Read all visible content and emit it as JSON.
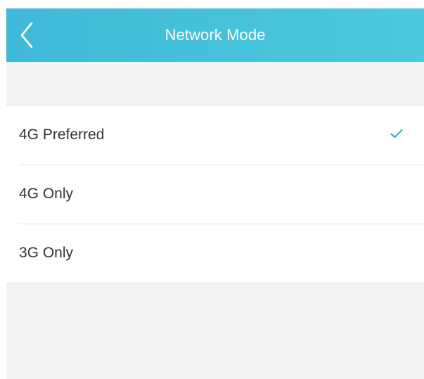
{
  "header": {
    "title": "Network Mode",
    "back_icon": "chevron-left-icon",
    "background_color": "#45c2da"
  },
  "options": [
    {
      "label": "4G Preferred",
      "selected": true
    },
    {
      "label": "4G Only",
      "selected": false
    },
    {
      "label": "3G Only",
      "selected": false
    }
  ],
  "check_icon": "checkmark-icon",
  "accent_color": "#2bb6c6"
}
